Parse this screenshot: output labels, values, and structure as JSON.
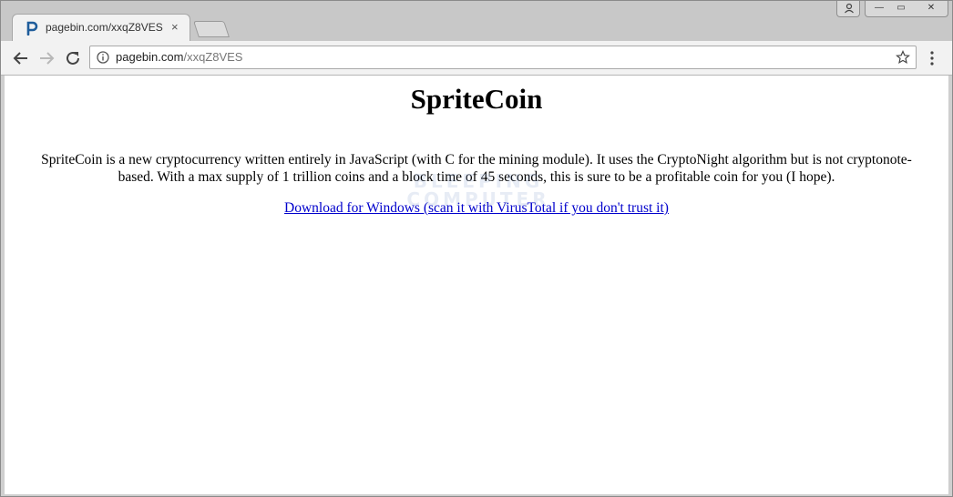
{
  "browser": {
    "tab": {
      "title": "pagebin.com/xxqZ8VES",
      "close_label": "×"
    },
    "address_bar": {
      "host": "pagebin.com",
      "path": "/xxqZ8VES"
    },
    "window_controls": {
      "minimize": "—",
      "maximize": "▭",
      "close": "✕"
    },
    "icons": {
      "favicon": "pagebin-p-icon",
      "back": "arrow-left-icon",
      "forward": "arrow-right-icon",
      "reload": "reload-icon",
      "info": "info-icon",
      "bookmark": "star-icon",
      "menu": "kebab-menu-icon",
      "user": "user-icon"
    },
    "colors": {
      "favicon": "#1f5d9b",
      "link": "#0000cc"
    }
  },
  "page": {
    "title": "SpriteCoin",
    "description": "SpriteCoin is a new cryptocurrency written entirely in JavaScript (with C for the mining module). It uses the CryptoNight algorithm but is not cryptonote-based. With a max supply of 1 trillion coins and a block time of 45 seconds, this is sure to be a profitable coin for you (I hope).",
    "download_link": "Download for Windows (scan it with VirusTotal if you don't trust it)"
  },
  "watermark": {
    "line1": "BLEEPING",
    "line2": "COMPUTER"
  }
}
